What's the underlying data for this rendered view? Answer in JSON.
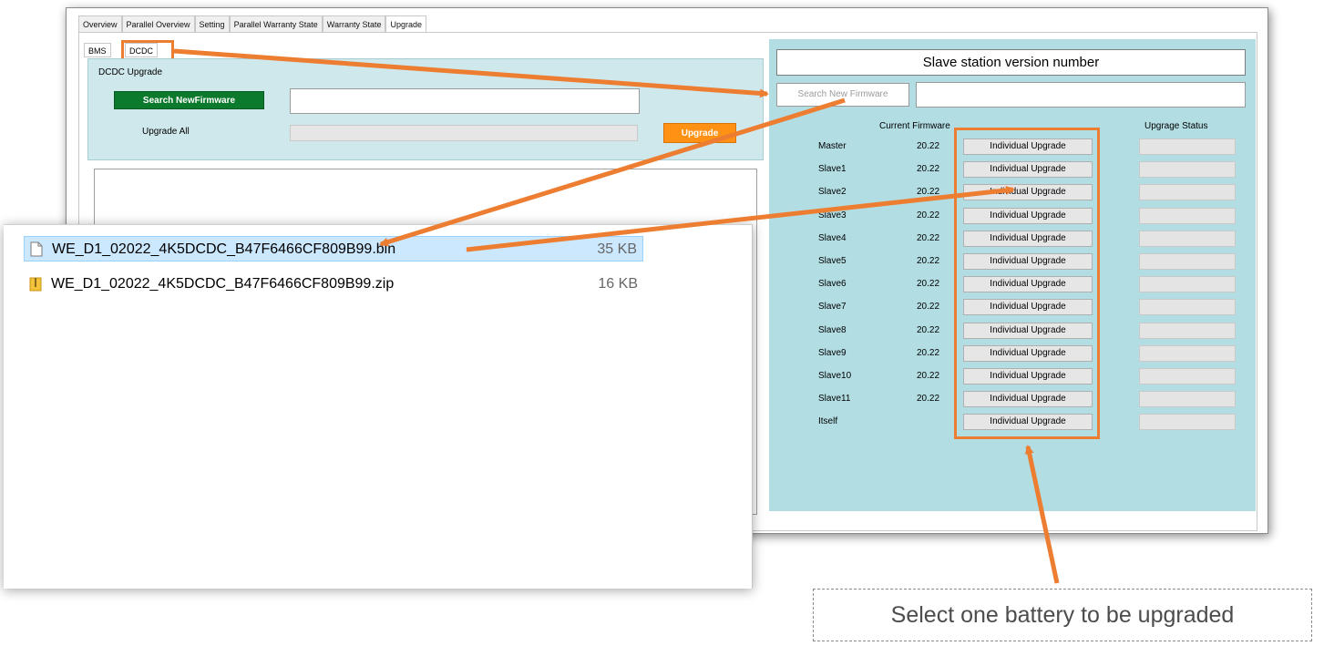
{
  "tabs": [
    "Overview",
    "Parallel Overview",
    "Setting",
    "Parallel Warranty State",
    "Warranty State",
    "Upgrade"
  ],
  "active_tab": "Upgrade",
  "subtabs": {
    "bms": "BMS",
    "dcdc": "DCDC"
  },
  "left": {
    "group_label": "DCDC Upgrade",
    "search_button": "Search NewFirmware",
    "search_input_value": "",
    "upgrade_all_label": "Upgrade All",
    "upgrade_button": "Upgrade"
  },
  "right": {
    "title": "Slave station version number",
    "search_button": "Search New Firmware",
    "search_input_value": "",
    "col_current": "Current Firmware",
    "col_status": "Upgrage Status",
    "button_label": "Individual Upgrade",
    "rows": [
      {
        "name": "Master",
        "version": "20.22"
      },
      {
        "name": "Slave1",
        "version": "20.22"
      },
      {
        "name": "Slave2",
        "version": "20.22"
      },
      {
        "name": "Slave3",
        "version": "20.22"
      },
      {
        "name": "Slave4",
        "version": "20.22"
      },
      {
        "name": "Slave5",
        "version": "20.22"
      },
      {
        "name": "Slave6",
        "version": "20.22"
      },
      {
        "name": "Slave7",
        "version": "20.22"
      },
      {
        "name": "Slave8",
        "version": "20.22"
      },
      {
        "name": "Slave9",
        "version": "20.22"
      },
      {
        "name": "Slave10",
        "version": "20.22"
      },
      {
        "name": "Slave11",
        "version": "20.22"
      },
      {
        "name": "Itself",
        "version": ""
      }
    ]
  },
  "files": [
    {
      "name": "WE_D1_02022_4K5DCDC_B47F6466CF809B99.bin",
      "size": "35 KB",
      "icon": "file-icon",
      "selected": true
    },
    {
      "name": "WE_D1_02022_4K5DCDC_B47F6466CF809B99.zip",
      "size": "16 KB",
      "icon": "zip-folder-icon",
      "selected": false
    }
  ],
  "caption": "Select one battery to be upgraded",
  "colors": {
    "accent": "#ed7d31",
    "panel": "#b2dde3",
    "green_button": "#0c7a2c",
    "orange_button": "#ff9214"
  }
}
